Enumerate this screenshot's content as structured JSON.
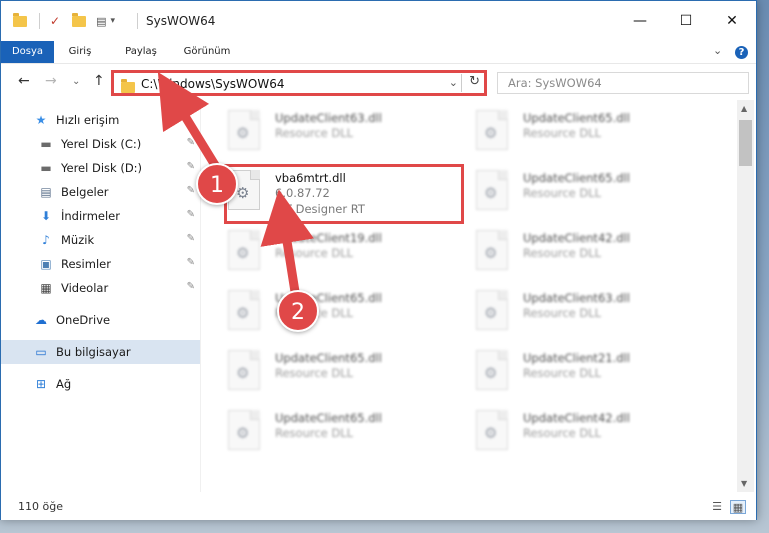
{
  "window": {
    "title": "SysWOW64",
    "minimize": "—",
    "maximize": "☐",
    "close": "✕"
  },
  "ribbon": {
    "tabs": [
      "Dosya",
      "Giriş",
      "Paylaş",
      "Görünüm"
    ],
    "help": "?",
    "expand": "⌄"
  },
  "address": {
    "back": "←",
    "forward": "→",
    "recent": "⌄",
    "up": "↑",
    "path": "C:\\Windows\\SysWOW64",
    "dropdown": "⌄",
    "refresh": "↻",
    "search_placeholder": "Ara: SysWOW64"
  },
  "sidebar": {
    "items": [
      {
        "label": "Hızlı erişim",
        "icon": "star-icon",
        "glyph": "★",
        "color": "#3a8ee6"
      },
      {
        "label": "Yerel Disk (C:)",
        "icon": "drive-icon",
        "glyph": "▬",
        "color": "#6b6b6b",
        "pinned": true
      },
      {
        "label": "Yerel Disk (D:)",
        "icon": "drive-icon",
        "glyph": "▬",
        "color": "#6b6b6b",
        "pinned": true
      },
      {
        "label": "Belgeler",
        "icon": "documents-icon",
        "glyph": "▤",
        "color": "#5a6f8a",
        "pinned": true
      },
      {
        "label": "İndirmeler",
        "icon": "download-icon",
        "glyph": "⬇",
        "color": "#2f7fd8",
        "pinned": true
      },
      {
        "label": "Müzik",
        "icon": "music-icon",
        "glyph": "♪",
        "color": "#2f7fd8",
        "pinned": true
      },
      {
        "label": "Resimler",
        "icon": "pictures-icon",
        "glyph": "▣",
        "color": "#4d7fb3",
        "pinned": true
      },
      {
        "label": "Videolar",
        "icon": "video-icon",
        "glyph": "▦",
        "color": "#444",
        "pinned": true
      },
      {
        "label": "OneDrive",
        "icon": "cloud-icon",
        "glyph": "☁",
        "color": "#1f6fd1"
      },
      {
        "label": "Bu bilgisayar",
        "icon": "computer-icon",
        "glyph": "▭",
        "color": "#1f6fd1",
        "selected": true
      },
      {
        "label": "Ağ",
        "icon": "network-icon",
        "glyph": "⊞",
        "color": "#2f7fd8"
      }
    ],
    "pin_glyph": "📌"
  },
  "files": {
    "highlighted": {
      "name": "vba6mtrt.dll",
      "version": "6.0.87.72",
      "description": "MT Designer RT"
    },
    "left_column": [
      {
        "name": "UpdateClient63.dll",
        "type": "Resource DLL"
      },
      {
        "name": "UpdateClient19.dll",
        "type": "Resource DLL"
      },
      {
        "name": "UpdateClient65.dll",
        "type": "Resource DLL"
      },
      {
        "name": "UpdateClient65.dll",
        "type": "Resource DLL"
      },
      {
        "name": "UpdateClient65.dll",
        "type": "Resource DLL"
      }
    ],
    "right_column": [
      {
        "name": "UpdateClient65.dll",
        "type": "Resource DLL"
      },
      {
        "name": "UpdateClient65.dll",
        "type": "Resource DLL"
      },
      {
        "name": "UpdateClient42.dll",
        "type": "Resource DLL"
      },
      {
        "name": "UpdateClient63.dll",
        "type": "Resource DLL"
      },
      {
        "name": "UpdateClient21.dll",
        "type": "Resource DLL"
      },
      {
        "name": "UpdateClient42.dll",
        "type": "Resource DLL"
      }
    ],
    "gear_glyph": "⚙"
  },
  "status": {
    "count": "110 öğe",
    "details_view": "☰",
    "tiles_view": "▦"
  },
  "annotations": {
    "step1": "1",
    "step2": "2",
    "color": "#e04848"
  }
}
